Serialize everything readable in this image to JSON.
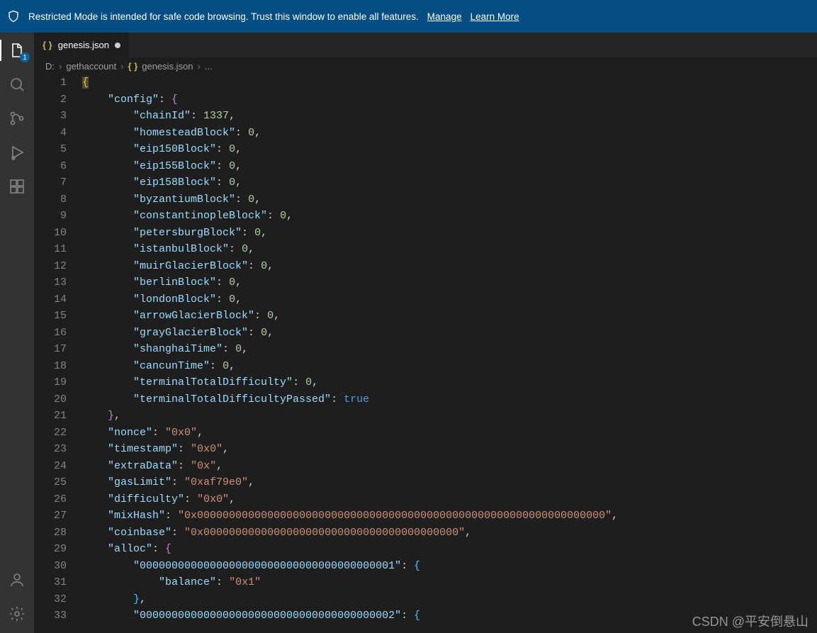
{
  "notification": {
    "message": "Restricted Mode is intended for safe code browsing. Trust this window to enable all features.",
    "manage": "Manage",
    "learn_more": "Learn More"
  },
  "activitybar": {
    "explorer_badge": "1"
  },
  "tab": {
    "icon": "{ }",
    "filename": "genesis.json"
  },
  "breadcrumb": {
    "drive": "D:",
    "folder": "gethaccount",
    "icon": "{ }",
    "file": "genesis.json",
    "trail": "..."
  },
  "code": {
    "lines": [
      {
        "n": 1,
        "indent": 0,
        "raw": [
          {
            "cls": "br cursor-hl",
            "t": "{"
          }
        ]
      },
      {
        "n": 2,
        "indent": 1,
        "raw": [
          {
            "cls": "k",
            "t": "\"config\""
          },
          {
            "cls": "p",
            "t": ": "
          },
          {
            "cls": "br2",
            "t": "{"
          }
        ]
      },
      {
        "n": 3,
        "indent": 2,
        "raw": [
          {
            "cls": "k",
            "t": "\"chainId\""
          },
          {
            "cls": "p",
            "t": ": "
          },
          {
            "cls": "n",
            "t": "1337"
          },
          {
            "cls": "p",
            "t": ","
          }
        ]
      },
      {
        "n": 4,
        "indent": 2,
        "raw": [
          {
            "cls": "k",
            "t": "\"homesteadBlock\""
          },
          {
            "cls": "p",
            "t": ": "
          },
          {
            "cls": "n",
            "t": "0"
          },
          {
            "cls": "p",
            "t": ","
          }
        ]
      },
      {
        "n": 5,
        "indent": 2,
        "raw": [
          {
            "cls": "k",
            "t": "\"eip150Block\""
          },
          {
            "cls": "p",
            "t": ": "
          },
          {
            "cls": "n",
            "t": "0"
          },
          {
            "cls": "p",
            "t": ","
          }
        ]
      },
      {
        "n": 6,
        "indent": 2,
        "raw": [
          {
            "cls": "k",
            "t": "\"eip155Block\""
          },
          {
            "cls": "p",
            "t": ": "
          },
          {
            "cls": "n",
            "t": "0"
          },
          {
            "cls": "p",
            "t": ","
          }
        ]
      },
      {
        "n": 7,
        "indent": 2,
        "raw": [
          {
            "cls": "k",
            "t": "\"eip158Block\""
          },
          {
            "cls": "p",
            "t": ": "
          },
          {
            "cls": "n",
            "t": "0"
          },
          {
            "cls": "p",
            "t": ","
          }
        ]
      },
      {
        "n": 8,
        "indent": 2,
        "raw": [
          {
            "cls": "k",
            "t": "\"byzantiumBlock\""
          },
          {
            "cls": "p",
            "t": ": "
          },
          {
            "cls": "n",
            "t": "0"
          },
          {
            "cls": "p",
            "t": ","
          }
        ]
      },
      {
        "n": 9,
        "indent": 2,
        "raw": [
          {
            "cls": "k",
            "t": "\"constantinopleBlock\""
          },
          {
            "cls": "p",
            "t": ": "
          },
          {
            "cls": "n",
            "t": "0"
          },
          {
            "cls": "p",
            "t": ","
          }
        ]
      },
      {
        "n": 10,
        "indent": 2,
        "raw": [
          {
            "cls": "k",
            "t": "\"petersburgBlock\""
          },
          {
            "cls": "p",
            "t": ": "
          },
          {
            "cls": "n",
            "t": "0"
          },
          {
            "cls": "p",
            "t": ","
          }
        ]
      },
      {
        "n": 11,
        "indent": 2,
        "raw": [
          {
            "cls": "k",
            "t": "\"istanbulBlock\""
          },
          {
            "cls": "p",
            "t": ": "
          },
          {
            "cls": "n",
            "t": "0"
          },
          {
            "cls": "p",
            "t": ","
          }
        ]
      },
      {
        "n": 12,
        "indent": 2,
        "raw": [
          {
            "cls": "k",
            "t": "\"muirGlacierBlock\""
          },
          {
            "cls": "p",
            "t": ": "
          },
          {
            "cls": "n",
            "t": "0"
          },
          {
            "cls": "p",
            "t": ","
          }
        ]
      },
      {
        "n": 13,
        "indent": 2,
        "raw": [
          {
            "cls": "k",
            "t": "\"berlinBlock\""
          },
          {
            "cls": "p",
            "t": ": "
          },
          {
            "cls": "n",
            "t": "0"
          },
          {
            "cls": "p",
            "t": ","
          }
        ]
      },
      {
        "n": 14,
        "indent": 2,
        "raw": [
          {
            "cls": "k",
            "t": "\"londonBlock\""
          },
          {
            "cls": "p",
            "t": ": "
          },
          {
            "cls": "n",
            "t": "0"
          },
          {
            "cls": "p",
            "t": ","
          }
        ]
      },
      {
        "n": 15,
        "indent": 2,
        "raw": [
          {
            "cls": "k",
            "t": "\"arrowGlacierBlock\""
          },
          {
            "cls": "p",
            "t": ": "
          },
          {
            "cls": "n",
            "t": "0"
          },
          {
            "cls": "p",
            "t": ","
          }
        ]
      },
      {
        "n": 16,
        "indent": 2,
        "raw": [
          {
            "cls": "k",
            "t": "\"grayGlacierBlock\""
          },
          {
            "cls": "p",
            "t": ": "
          },
          {
            "cls": "n",
            "t": "0"
          },
          {
            "cls": "p",
            "t": ","
          }
        ]
      },
      {
        "n": 17,
        "indent": 2,
        "raw": [
          {
            "cls": "k",
            "t": "\"shanghaiTime\""
          },
          {
            "cls": "p",
            "t": ": "
          },
          {
            "cls": "n",
            "t": "0"
          },
          {
            "cls": "p",
            "t": ","
          }
        ]
      },
      {
        "n": 18,
        "indent": 2,
        "raw": [
          {
            "cls": "k",
            "t": "\"cancunTime\""
          },
          {
            "cls": "p",
            "t": ": "
          },
          {
            "cls": "n",
            "t": "0"
          },
          {
            "cls": "p",
            "t": ","
          }
        ]
      },
      {
        "n": 19,
        "indent": 2,
        "raw": [
          {
            "cls": "k",
            "t": "\"terminalTotalDifficulty\""
          },
          {
            "cls": "p",
            "t": ": "
          },
          {
            "cls": "n",
            "t": "0"
          },
          {
            "cls": "p",
            "t": ","
          }
        ]
      },
      {
        "n": 20,
        "indent": 2,
        "raw": [
          {
            "cls": "k",
            "t": "\"terminalTotalDifficultyPassed\""
          },
          {
            "cls": "p",
            "t": ": "
          },
          {
            "cls": "b",
            "t": "true"
          }
        ]
      },
      {
        "n": 21,
        "indent": 1,
        "raw": [
          {
            "cls": "br2",
            "t": "}"
          },
          {
            "cls": "p",
            "t": ","
          }
        ]
      },
      {
        "n": 22,
        "indent": 1,
        "raw": [
          {
            "cls": "k",
            "t": "\"nonce\""
          },
          {
            "cls": "p",
            "t": ": "
          },
          {
            "cls": "s",
            "t": "\"0x0\""
          },
          {
            "cls": "p",
            "t": ","
          }
        ]
      },
      {
        "n": 23,
        "indent": 1,
        "raw": [
          {
            "cls": "k",
            "t": "\"timestamp\""
          },
          {
            "cls": "p",
            "t": ": "
          },
          {
            "cls": "s",
            "t": "\"0x0\""
          },
          {
            "cls": "p",
            "t": ","
          }
        ]
      },
      {
        "n": 24,
        "indent": 1,
        "raw": [
          {
            "cls": "k",
            "t": "\"extraData\""
          },
          {
            "cls": "p",
            "t": ": "
          },
          {
            "cls": "s",
            "t": "\"0x\""
          },
          {
            "cls": "p",
            "t": ","
          }
        ]
      },
      {
        "n": 25,
        "indent": 1,
        "raw": [
          {
            "cls": "k",
            "t": "\"gasLimit\""
          },
          {
            "cls": "p",
            "t": ": "
          },
          {
            "cls": "s",
            "t": "\"0xaf79e0\""
          },
          {
            "cls": "p",
            "t": ","
          }
        ]
      },
      {
        "n": 26,
        "indent": 1,
        "raw": [
          {
            "cls": "k",
            "t": "\"difficulty\""
          },
          {
            "cls": "p",
            "t": ": "
          },
          {
            "cls": "s",
            "t": "\"0x0\""
          },
          {
            "cls": "p",
            "t": ","
          }
        ]
      },
      {
        "n": 27,
        "indent": 1,
        "raw": [
          {
            "cls": "k",
            "t": "\"mixHash\""
          },
          {
            "cls": "p",
            "t": ": "
          },
          {
            "cls": "s",
            "t": "\"0x0000000000000000000000000000000000000000000000000000000000000000\""
          },
          {
            "cls": "p",
            "t": ","
          }
        ]
      },
      {
        "n": 28,
        "indent": 1,
        "raw": [
          {
            "cls": "k",
            "t": "\"coinbase\""
          },
          {
            "cls": "p",
            "t": ": "
          },
          {
            "cls": "s",
            "t": "\"0x0000000000000000000000000000000000000000\""
          },
          {
            "cls": "p",
            "t": ","
          }
        ]
      },
      {
        "n": 29,
        "indent": 1,
        "raw": [
          {
            "cls": "k",
            "t": "\"alloc\""
          },
          {
            "cls": "p",
            "t": ": "
          },
          {
            "cls": "br2",
            "t": "{"
          }
        ]
      },
      {
        "n": 30,
        "indent": 2,
        "raw": [
          {
            "cls": "k",
            "t": "\"0000000000000000000000000000000000000001\""
          },
          {
            "cls": "p",
            "t": ": "
          },
          {
            "cls": "br3",
            "t": "{"
          }
        ]
      },
      {
        "n": 31,
        "indent": 3,
        "raw": [
          {
            "cls": "k",
            "t": "\"balance\""
          },
          {
            "cls": "p",
            "t": ": "
          },
          {
            "cls": "s",
            "t": "\"0x1\""
          }
        ]
      },
      {
        "n": 32,
        "indent": 2,
        "raw": [
          {
            "cls": "br3",
            "t": "}"
          },
          {
            "cls": "p",
            "t": ","
          }
        ]
      },
      {
        "n": 33,
        "indent": 2,
        "raw": [
          {
            "cls": "k",
            "t": "\"0000000000000000000000000000000000000002\""
          },
          {
            "cls": "p",
            "t": ": "
          },
          {
            "cls": "br3",
            "t": "{"
          }
        ]
      }
    ]
  },
  "watermark": "CSDN @平安倒悬山"
}
